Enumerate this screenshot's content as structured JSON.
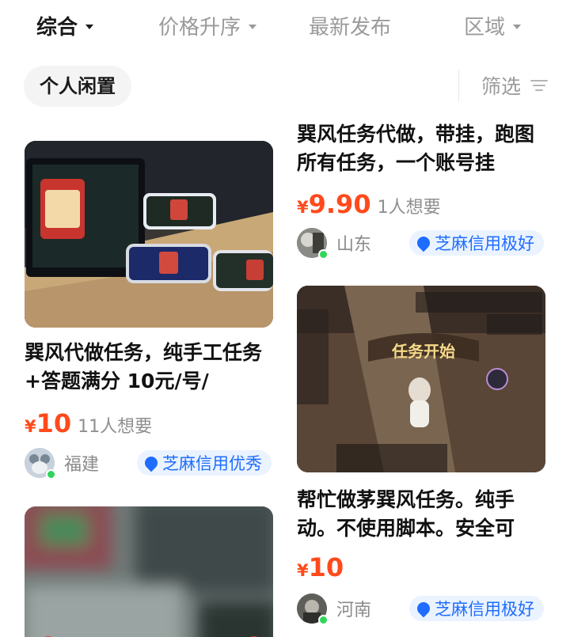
{
  "sort_bar": {
    "items": [
      {
        "label": "综合"
      },
      {
        "label": "价格升序"
      },
      {
        "label": "最新发布"
      },
      {
        "label": "区域"
      }
    ]
  },
  "chip": {
    "label": "个人闲置"
  },
  "filter": {
    "label": "筛选",
    "icon": "filter-icon"
  },
  "cards": [
    {
      "title": "巽风代做任务，纯手工任务+答题满分 10元/号/",
      "currency": "¥",
      "price": "10",
      "wants": "11人想要",
      "region": "福建",
      "credit": "芝麻信用优秀",
      "image": "phones-and-tablet-on-desk-photo"
    },
    {
      "title": "巽风任务代做，带挂，跑图所有任务，一个账号挂",
      "currency": "¥",
      "price": "9.90",
      "wants": "1人想要",
      "region": "山东",
      "credit": "芝麻信用极好"
    },
    {
      "title": "帮忙做茅巽风任务。纯手动。不使用脚本。安全可",
      "currency": "¥",
      "price": "10",
      "wants": "",
      "region": "河南",
      "credit": "芝麻信用极好",
      "image": "game-screenshot-task-start",
      "image_text": "任务开始"
    },
    {
      "image": "blurred-photo"
    }
  ],
  "colors": {
    "price": "#ff4a1c",
    "credit_text": "#1f6dff",
    "credit_bg": "#eaf3ff",
    "online_dot": "#2fd65a"
  }
}
